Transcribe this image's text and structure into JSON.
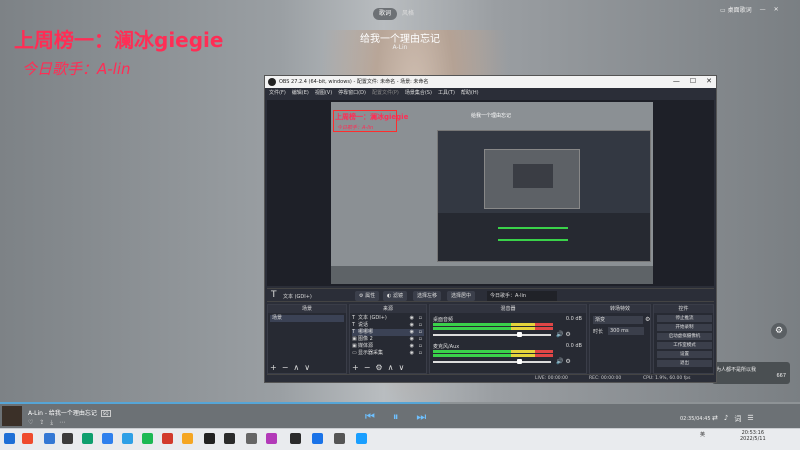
{
  "player": {
    "tabs": [
      "歌词",
      "风格"
    ],
    "song_title": "给我一个理由忘记",
    "song_artist": "A-Lin",
    "overlay_line1": "上周榜一：澜冰giegie",
    "overlay_line2": "今日歌手：A-lin",
    "window_label": "桌面歌词",
    "toast_line1": "为人都不是所以我",
    "toast_line2": "667",
    "bottom": {
      "track": "A-Lin - 给我一个理由忘记",
      "badge": "SQ",
      "time": "02:35/04:45",
      "play_progress": 0.55,
      "controls": [
        "⏮",
        "⏸",
        "⏭"
      ],
      "right_icons": [
        "⇄",
        "♪",
        "词",
        "☰"
      ],
      "left_icons": [
        "♡",
        "⇪",
        "⤓",
        "⋯"
      ]
    }
  },
  "taskbar": {
    "icons": [
      "#1e6fd6",
      "#ef4b2e",
      "#3478d4",
      "#3c3c3c",
      "#0e9f6e",
      "#2f80ed",
      "#2fa0e6",
      "#1db954",
      "#d23b2c",
      "#f5a623",
      "#222222",
      "#2b2b2b",
      "#666666",
      "#b33ab8",
      "#2b2b2b",
      "#1a73e8",
      "#555555",
      "#1a9fff"
    ],
    "tray": "英",
    "clock_time": "20:53:16",
    "clock_date": "2022/5/11"
  },
  "obs": {
    "title": "OBS 27.2.4 (64-bit, windows) - 配置文件: 未命名 - 场景: 未命名",
    "window_buttons": [
      "—",
      "☐",
      "✕"
    ],
    "menu": [
      "文件(F)",
      "编辑(E)",
      "视图(V)",
      "停靠窗口(D)",
      "配置文件(P)",
      "场景集合(S)",
      "工具(T)",
      "帮助(H)"
    ],
    "preview": {
      "overlay_line1": "上周榜一：澜冰giegie",
      "overlay_line2": "今日歌手：A-lin",
      "song": "给我一个理由忘记"
    },
    "toolbar": {
      "source_label": "文本 (GDI+)",
      "properties": "属性",
      "filters": "滤镜",
      "select_left": "选择左移",
      "select_right": "选择居中",
      "text_value": "今日歌手：A-lin"
    },
    "docks": {
      "scenes_title": "场景",
      "sources_title": "来源",
      "mixer_title": "混音器",
      "transitions_title": "转场特效",
      "controls_title": "控件"
    },
    "scenes": [
      "场景"
    ],
    "sources": [
      {
        "icon": "T",
        "name": "文本 (GDI+)"
      },
      {
        "icon": "T",
        "name": "说话"
      },
      {
        "icon": "T",
        "name": "哪哪哪"
      },
      {
        "icon": "▣",
        "name": "图像 2"
      },
      {
        "icon": "▣",
        "name": "媒体源"
      },
      {
        "icon": "▭",
        "name": "显示器采集"
      }
    ],
    "mixer": [
      {
        "name": "桌面音频",
        "db": "0.0 dB",
        "level": 0.73
      },
      {
        "name": "麦克风/Aux",
        "db": "0.0 dB",
        "level": 0.73
      }
    ],
    "transition": {
      "type": "渐变",
      "duration_label": "时长",
      "duration": "300 ms"
    },
    "controls": [
      "停止推流",
      "开始录制",
      "启动虚拟摄像机",
      "工作室模式",
      "设置",
      "退出"
    ],
    "status": {
      "live": "LIVE: 00:00:00",
      "rec": "REC: 00:00:00",
      "cpu": "CPU: 1.9%, 60.00 fps"
    },
    "bottom_icons": [
      "+",
      "−",
      "∧",
      "∨",
      "⚙"
    ]
  }
}
